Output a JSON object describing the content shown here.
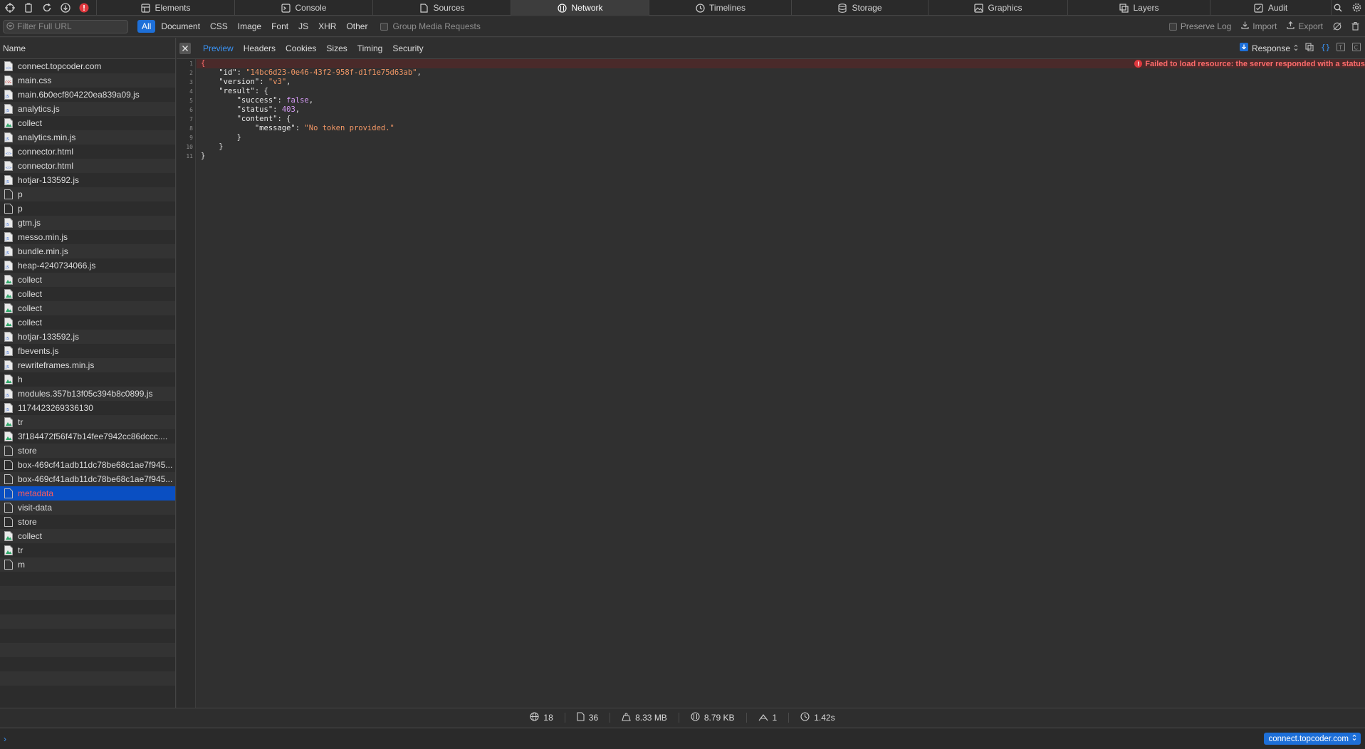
{
  "toolbar": {
    "tabs": [
      {
        "label": "Elements",
        "icon": "elements-icon",
        "active": false
      },
      {
        "label": "Console",
        "icon": "console-icon",
        "active": false
      },
      {
        "label": "Sources",
        "icon": "sources-icon",
        "active": false
      },
      {
        "label": "Network",
        "icon": "network-icon",
        "active": true
      },
      {
        "label": "Timelines",
        "icon": "timelines-icon",
        "active": false
      },
      {
        "label": "Storage",
        "icon": "storage-icon",
        "active": false
      },
      {
        "label": "Graphics",
        "icon": "graphics-icon",
        "active": false
      },
      {
        "label": "Layers",
        "icon": "layers-icon",
        "active": false
      },
      {
        "label": "Audit",
        "icon": "audit-icon",
        "active": false
      }
    ]
  },
  "filterbar": {
    "search_placeholder": "Filter Full URL",
    "types": [
      "All",
      "Document",
      "CSS",
      "Image",
      "Font",
      "JS",
      "XHR",
      "Other"
    ],
    "active_type": "All",
    "group_media_label": "Group Media Requests",
    "preserve_log_label": "Preserve Log",
    "import_label": "Import",
    "export_label": "Export"
  },
  "sidebar": {
    "header": "Name",
    "selected_index": 30,
    "items": [
      {
        "name": "connect.topcoder.com",
        "icon": "document-file-icon"
      },
      {
        "name": "main.css",
        "icon": "css-file-icon"
      },
      {
        "name": "main.6b0ecf804220ea839a09.js",
        "icon": "js-file-icon"
      },
      {
        "name": "analytics.js",
        "icon": "js-file-icon"
      },
      {
        "name": "collect",
        "icon": "image-file-icon"
      },
      {
        "name": "analytics.min.js",
        "icon": "js-file-icon"
      },
      {
        "name": "connector.html",
        "icon": "document-file-icon"
      },
      {
        "name": "connector.html",
        "icon": "document-file-icon"
      },
      {
        "name": "hotjar-133592.js",
        "icon": "js-file-icon"
      },
      {
        "name": "p",
        "icon": "generic-file-icon"
      },
      {
        "name": "p",
        "icon": "generic-file-icon"
      },
      {
        "name": "gtm.js",
        "icon": "js-file-icon"
      },
      {
        "name": "messo.min.js",
        "icon": "js-file-icon"
      },
      {
        "name": "bundle.min.js",
        "icon": "js-file-icon"
      },
      {
        "name": "heap-4240734066.js",
        "icon": "js-file-icon"
      },
      {
        "name": "collect",
        "icon": "image-file-icon"
      },
      {
        "name": "collect",
        "icon": "image-file-icon"
      },
      {
        "name": "collect",
        "icon": "image-file-icon"
      },
      {
        "name": "collect",
        "icon": "image-file-icon"
      },
      {
        "name": "hotjar-133592.js",
        "icon": "js-file-icon"
      },
      {
        "name": "fbevents.js",
        "icon": "js-file-icon"
      },
      {
        "name": "rewriteframes.min.js",
        "icon": "js-file-icon"
      },
      {
        "name": "h",
        "icon": "image-file-icon"
      },
      {
        "name": "modules.357b13f05c394b8c0899.js",
        "icon": "js-file-icon"
      },
      {
        "name": "1174423269336130",
        "icon": "js-file-icon"
      },
      {
        "name": "tr",
        "icon": "image-file-icon"
      },
      {
        "name": "3f184472f56f47b14fee7942cc86dccc....",
        "icon": "image-file-icon"
      },
      {
        "name": "store",
        "icon": "generic-file-icon"
      },
      {
        "name": "box-469cf41adb11dc78be68c1ae7f945...",
        "icon": "generic-file-icon"
      },
      {
        "name": "box-469cf41adb11dc78be68c1ae7f945...",
        "icon": "generic-file-icon"
      },
      {
        "name": "metadata",
        "icon": "generic-file-icon"
      },
      {
        "name": "visit-data",
        "icon": "generic-file-icon"
      },
      {
        "name": "store",
        "icon": "generic-file-icon"
      },
      {
        "name": "collect",
        "icon": "image-file-icon"
      },
      {
        "name": "tr",
        "icon": "image-file-icon"
      },
      {
        "name": "m",
        "icon": "generic-file-icon"
      }
    ]
  },
  "detail": {
    "tabs": [
      "Preview",
      "Headers",
      "Cookies",
      "Sizes",
      "Timing",
      "Security"
    ],
    "active_tab": "Preview",
    "response_label": "Response",
    "error_message": "Failed to load resource: the server responded with a status",
    "line_numbers": [
      "1",
      "2",
      "3",
      "4",
      "5",
      "6",
      "7",
      "8",
      "9",
      "10",
      "11"
    ],
    "json": {
      "id": "14bc6d23-0e46-43f2-958f-d1f1e75d63ab",
      "version": "v3",
      "success": "false",
      "status": "403",
      "message": "No token provided."
    }
  },
  "statusbar": {
    "requests": "18",
    "resources": "36",
    "resource_size": "8.33 MB",
    "transferred": "8.79 KB",
    "redirects": "1",
    "time": "1.42s"
  },
  "console": {
    "prompt": "›",
    "context": "connect.topcoder.com"
  },
  "colors": {
    "accent": "#1d6fd8",
    "selection": "#0a4fc2",
    "error": "#e0383e",
    "string": "#f29766",
    "keyword": "#d79cf7"
  }
}
